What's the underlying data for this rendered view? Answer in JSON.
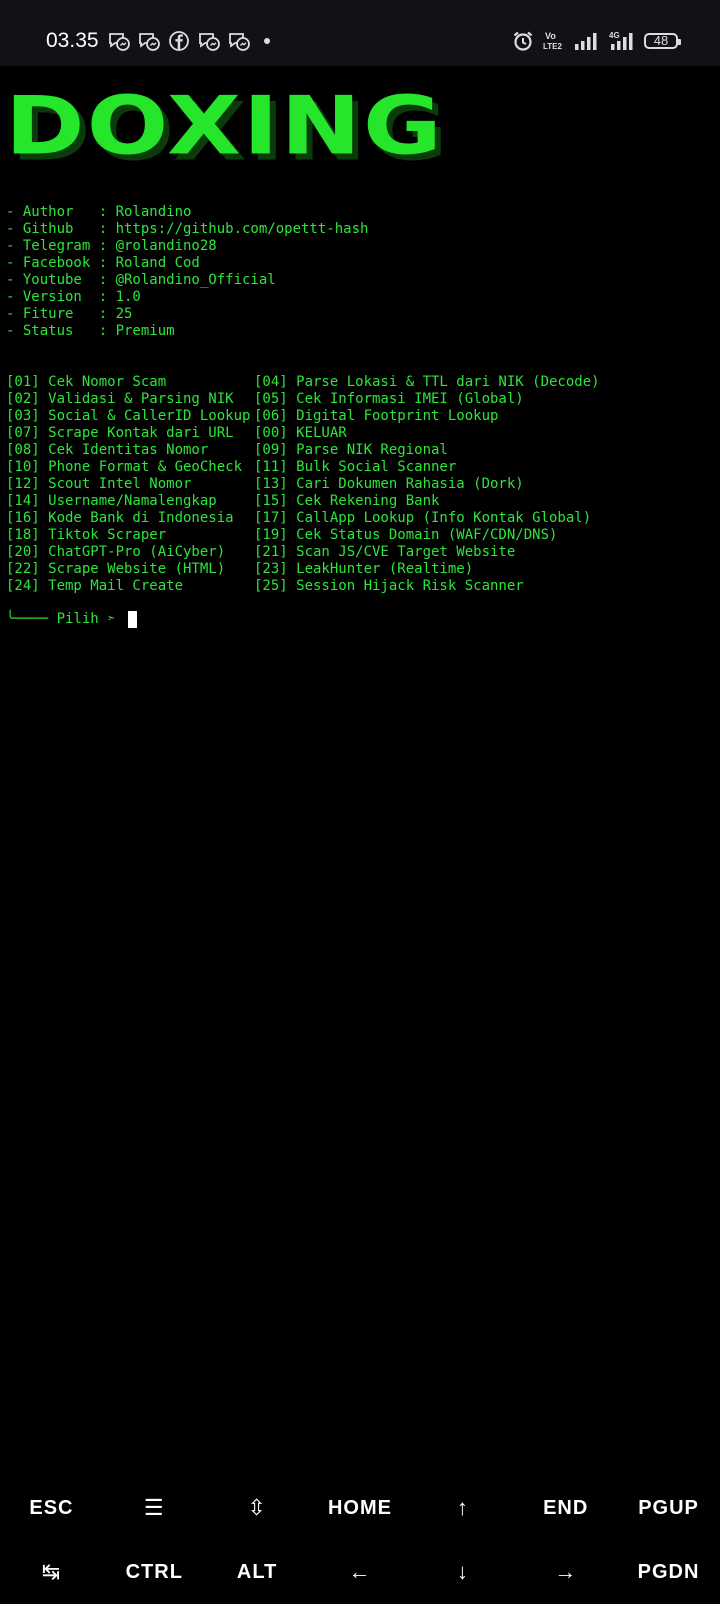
{
  "status_bar": {
    "time": "03.35",
    "notification_icons": [
      "messenger-icon",
      "messenger-icon",
      "facebook-icon",
      "messenger-icon",
      "messenger-icon"
    ],
    "right_icons": [
      "alarm-icon",
      "volte-icon",
      "signal-icon",
      "4g-signal-icon"
    ],
    "volte_label": "Vo LTE2",
    "network_label": "4G",
    "battery_level": "48"
  },
  "terminal": {
    "banner": "DOXING",
    "banner_color": "#25e62b",
    "text_color": "#2de53a",
    "info": [
      "- Author   : Rolandino",
      "- Github   : https://github.com/opettt-hash",
      "- Telegram : @rolandino28",
      "- Facebook : Roland Cod",
      "- Youtube  : @Rolandino_Official",
      "- Version  : 1.0",
      "- Fiture   : 25",
      "- Status   : Premium"
    ],
    "menu_left": [
      "[01] Cek Nomor Scam",
      "[02] Validasi & Parsing NIK",
      "[03] Social & CallerID Lookup",
      "[07] Scrape Kontak dari URL",
      "[08] Cek Identitas Nomor",
      "[10] Phone Format & GeoCheck",
      "[12] Scout Intel Nomor",
      "[14] Username/Namalengkap",
      "[16] Kode Bank di Indonesia",
      "[18] Tiktok Scraper",
      "[20] ChatGPT-Pro (AiCyber)",
      "[22] Scrape Website (HTML)",
      "[24] Temp Mail Create"
    ],
    "menu_right": [
      "[04] Parse Lokasi & TTL dari NIK (Decode)",
      "[05] Cek Informasi IMEI (Global)",
      "[06] Digital Footprint Lookup",
      "[00] KELUAR",
      "[09] Parse NIK Regional",
      "[11] Bulk Social Scanner",
      "[13] Cari Dokumen Rahasia (Dork)",
      "[15] Cek Rekening Bank",
      "[17] CallApp Lookup (Info Kontak Global)",
      "[19] Cek Status Domain (WAF/CDN/DNS)",
      "[21] Scan JS/CVE Target Website",
      "[23] LeakHunter (Realtime)",
      "[25] Session Hijack Risk Scanner"
    ],
    "prompt": "╰──── Pilih ➣ ",
    "input_value": ""
  },
  "extra_keys": {
    "row1": [
      "ESC",
      "☰",
      "⇳",
      "HOME",
      "↑",
      "END",
      "PGUP"
    ],
    "row2": [
      "↹",
      "CTRL",
      "ALT",
      "←",
      "↓",
      "→",
      "PGDN"
    ]
  }
}
